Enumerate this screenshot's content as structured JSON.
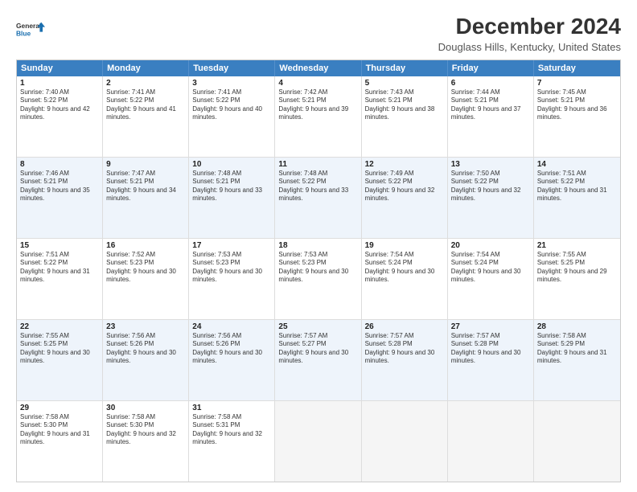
{
  "logo": {
    "line1": "General",
    "line2": "Blue"
  },
  "title": "December 2024",
  "subtitle": "Douglass Hills, Kentucky, United States",
  "days_of_week": [
    "Sunday",
    "Monday",
    "Tuesday",
    "Wednesday",
    "Thursday",
    "Friday",
    "Saturday"
  ],
  "weeks": [
    [
      {
        "day": 1,
        "sunrise": "7:40 AM",
        "sunset": "5:22 PM",
        "daylight": "9 hours and 42 minutes."
      },
      {
        "day": 2,
        "sunrise": "7:41 AM",
        "sunset": "5:22 PM",
        "daylight": "9 hours and 41 minutes."
      },
      {
        "day": 3,
        "sunrise": "7:41 AM",
        "sunset": "5:22 PM",
        "daylight": "9 hours and 40 minutes."
      },
      {
        "day": 4,
        "sunrise": "7:42 AM",
        "sunset": "5:21 PM",
        "daylight": "9 hours and 39 minutes."
      },
      {
        "day": 5,
        "sunrise": "7:43 AM",
        "sunset": "5:21 PM",
        "daylight": "9 hours and 38 minutes."
      },
      {
        "day": 6,
        "sunrise": "7:44 AM",
        "sunset": "5:21 PM",
        "daylight": "9 hours and 37 minutes."
      },
      {
        "day": 7,
        "sunrise": "7:45 AM",
        "sunset": "5:21 PM",
        "daylight": "9 hours and 36 minutes."
      }
    ],
    [
      {
        "day": 8,
        "sunrise": "7:46 AM",
        "sunset": "5:21 PM",
        "daylight": "9 hours and 35 minutes."
      },
      {
        "day": 9,
        "sunrise": "7:47 AM",
        "sunset": "5:21 PM",
        "daylight": "9 hours and 34 minutes."
      },
      {
        "day": 10,
        "sunrise": "7:48 AM",
        "sunset": "5:21 PM",
        "daylight": "9 hours and 33 minutes."
      },
      {
        "day": 11,
        "sunrise": "7:48 AM",
        "sunset": "5:22 PM",
        "daylight": "9 hours and 33 minutes."
      },
      {
        "day": 12,
        "sunrise": "7:49 AM",
        "sunset": "5:22 PM",
        "daylight": "9 hours and 32 minutes."
      },
      {
        "day": 13,
        "sunrise": "7:50 AM",
        "sunset": "5:22 PM",
        "daylight": "9 hours and 32 minutes."
      },
      {
        "day": 14,
        "sunrise": "7:51 AM",
        "sunset": "5:22 PM",
        "daylight": "9 hours and 31 minutes."
      }
    ],
    [
      {
        "day": 15,
        "sunrise": "7:51 AM",
        "sunset": "5:22 PM",
        "daylight": "9 hours and 31 minutes."
      },
      {
        "day": 16,
        "sunrise": "7:52 AM",
        "sunset": "5:23 PM",
        "daylight": "9 hours and 30 minutes."
      },
      {
        "day": 17,
        "sunrise": "7:53 AM",
        "sunset": "5:23 PM",
        "daylight": "9 hours and 30 minutes."
      },
      {
        "day": 18,
        "sunrise": "7:53 AM",
        "sunset": "5:23 PM",
        "daylight": "9 hours and 30 minutes."
      },
      {
        "day": 19,
        "sunrise": "7:54 AM",
        "sunset": "5:24 PM",
        "daylight": "9 hours and 30 minutes."
      },
      {
        "day": 20,
        "sunrise": "7:54 AM",
        "sunset": "5:24 PM",
        "daylight": "9 hours and 30 minutes."
      },
      {
        "day": 21,
        "sunrise": "7:55 AM",
        "sunset": "5:25 PM",
        "daylight": "9 hours and 29 minutes."
      }
    ],
    [
      {
        "day": 22,
        "sunrise": "7:55 AM",
        "sunset": "5:25 PM",
        "daylight": "9 hours and 30 minutes."
      },
      {
        "day": 23,
        "sunrise": "7:56 AM",
        "sunset": "5:26 PM",
        "daylight": "9 hours and 30 minutes."
      },
      {
        "day": 24,
        "sunrise": "7:56 AM",
        "sunset": "5:26 PM",
        "daylight": "9 hours and 30 minutes."
      },
      {
        "day": 25,
        "sunrise": "7:57 AM",
        "sunset": "5:27 PM",
        "daylight": "9 hours and 30 minutes."
      },
      {
        "day": 26,
        "sunrise": "7:57 AM",
        "sunset": "5:28 PM",
        "daylight": "9 hours and 30 minutes."
      },
      {
        "day": 27,
        "sunrise": "7:57 AM",
        "sunset": "5:28 PM",
        "daylight": "9 hours and 30 minutes."
      },
      {
        "day": 28,
        "sunrise": "7:58 AM",
        "sunset": "5:29 PM",
        "daylight": "9 hours and 31 minutes."
      }
    ],
    [
      {
        "day": 29,
        "sunrise": "7:58 AM",
        "sunset": "5:30 PM",
        "daylight": "9 hours and 31 minutes."
      },
      {
        "day": 30,
        "sunrise": "7:58 AM",
        "sunset": "5:30 PM",
        "daylight": "9 hours and 32 minutes."
      },
      {
        "day": 31,
        "sunrise": "7:58 AM",
        "sunset": "5:31 PM",
        "daylight": "9 hours and 32 minutes."
      },
      null,
      null,
      null,
      null
    ]
  ]
}
